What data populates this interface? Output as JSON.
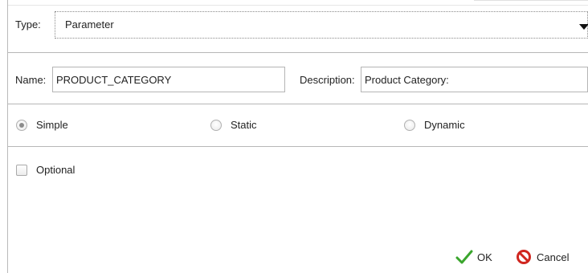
{
  "dialog": {
    "type": {
      "label": "Type:",
      "value": "Parameter"
    },
    "name": {
      "label": "Name:",
      "value": "PRODUCT_CATEGORY"
    },
    "description": {
      "label": "Description:",
      "value": "Product Category:"
    },
    "mode_options": [
      {
        "label": "Simple",
        "selected": true
      },
      {
        "label": "Static",
        "selected": false
      },
      {
        "label": "Dynamic",
        "selected": false
      }
    ],
    "optional": {
      "label": "Optional",
      "checked": false
    },
    "buttons": {
      "ok": "OK",
      "cancel": "Cancel"
    },
    "colors": {
      "ok_check": "#3aa52d",
      "cancel_icon": "#d0261f"
    }
  }
}
